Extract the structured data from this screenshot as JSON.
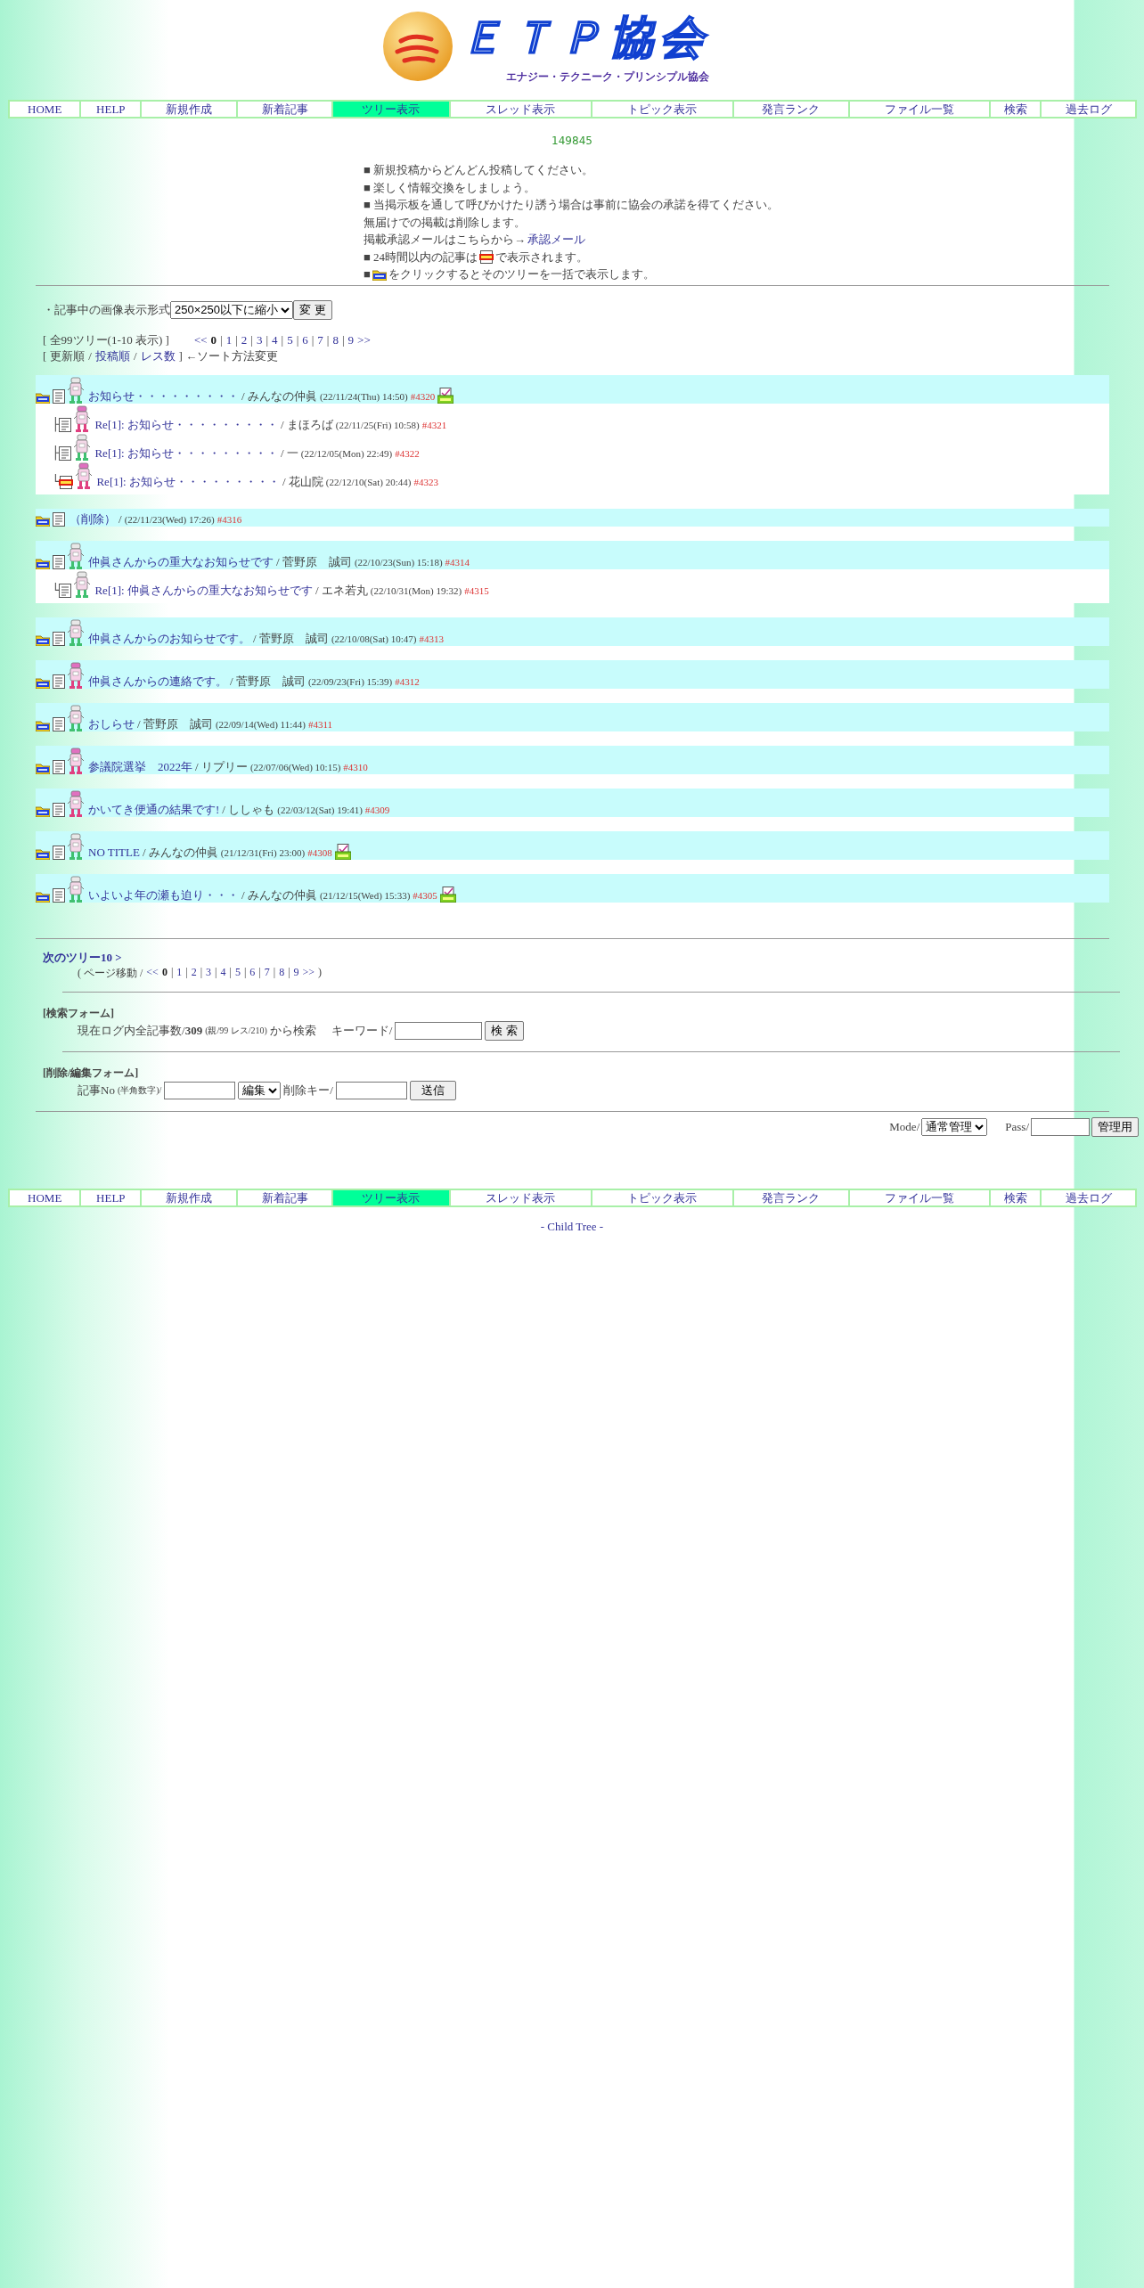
{
  "logo": {
    "title": "ＥＴＰ協会",
    "subtitle": "エナジー・テクニーク・プリンシプル協会"
  },
  "nav_top": [
    {
      "label": "HOME",
      "selected": false
    },
    {
      "label": "HELP",
      "selected": false
    },
    {
      "label": "新規作成",
      "selected": false
    },
    {
      "label": "新着記事",
      "selected": false
    },
    {
      "label": "ツリー表示",
      "selected": true
    },
    {
      "label": "スレッド表示",
      "selected": false
    },
    {
      "label": "トピック表示",
      "selected": false
    },
    {
      "label": "発言ランク",
      "selected": false
    },
    {
      "label": "ファイル一覧",
      "selected": false
    },
    {
      "label": "検索",
      "selected": false
    },
    {
      "label": "過去ログ",
      "selected": false
    }
  ],
  "counter": "149845",
  "notices": [
    {
      "kind": "text",
      "text": "■ 新規投稿からどんどん投稿してください。"
    },
    {
      "kind": "text",
      "text": "■ 楽しく情報交換をしましょう。"
    },
    {
      "kind": "text",
      "text": "■ 当掲示板を通して呼びかけたり誘う場合は事前に協会の承諾を得てください。"
    },
    {
      "kind": "text",
      "text": "無届けでの掲載は削除します。"
    },
    {
      "kind": "link",
      "text": "掲載承認メールはこちらから→",
      "link": "承認メール"
    },
    {
      "kind": "new_icon",
      "before": "■ 24時間以内の記事は",
      "after": "で表示されます。"
    },
    {
      "kind": "all_icon",
      "before": "■",
      "after": "をクリックするとそのツリーを一括で表示します。"
    }
  ],
  "image_format": {
    "label": "・記事中の画像表示形式",
    "value": "250×250以下に縮小",
    "button": "変 更"
  },
  "summary": "[ 全99ツリー(1-10 表示) ]",
  "pages": {
    "prev": "<<",
    "next": ">>",
    "separator": "|",
    "items": [
      {
        "label": "0",
        "selected": true
      },
      {
        "label": "1",
        "selected": false
      },
      {
        "label": "2",
        "selected": false
      },
      {
        "label": "3",
        "selected": false
      },
      {
        "label": "4",
        "selected": false
      },
      {
        "label": "5",
        "selected": false
      },
      {
        "label": "6",
        "selected": false
      },
      {
        "label": "7",
        "selected": false
      },
      {
        "label": "8",
        "selected": false
      },
      {
        "label": "9",
        "selected": false
      }
    ]
  },
  "sort": {
    "open": "[",
    "separator": "/",
    "close": "] ←ソート方法変更",
    "options": [
      {
        "label": "更新順",
        "selected": true
      },
      {
        "label": "投稿順",
        "selected": false
      },
      {
        "label": "レス数",
        "selected": false
      }
    ]
  },
  "threads": [
    {
      "post": {
        "title": "お知らせ・・・・・・・・・",
        "byline": "/ みんなの仲眞",
        "date": "(22/11/24(Thu) 14:50)",
        "number": "#4320",
        "kind": "green",
        "new": false,
        "image": true
      },
      "children": [
        {
          "branch": "├",
          "title": "Re[1]: お知らせ・・・・・・・・・",
          "byline": "/ まほろば",
          "date": "(22/11/25(Fri) 10:58)",
          "number": "#4321",
          "kind": "pink",
          "new": false
        },
        {
          "branch": "├",
          "title": "Re[1]: お知らせ・・・・・・・・・",
          "byline": "/ 一",
          "date": "(22/12/05(Mon) 22:49)",
          "number": "#4322",
          "kind": "green",
          "new": false
        },
        {
          "branch": "└",
          "title": "Re[1]: お知らせ・・・・・・・・・",
          "byline": "/ 花山院",
          "date": "(22/12/10(Sat) 20:44)",
          "number": "#4323",
          "kind": "pink",
          "new": true
        }
      ]
    },
    {
      "post": {
        "title": "（削除）",
        "byline": "/",
        "date": "(22/11/23(Wed) 17:26)",
        "number": "#4316",
        "kind": "deleted",
        "new": false
      }
    },
    {
      "post": {
        "title": "仲眞さんからの重大なお知らせです",
        "byline": "/ 菅野原　誠司",
        "date": "(22/10/23(Sun) 15:18)",
        "number": "#4314",
        "kind": "green",
        "new": false
      },
      "children": [
        {
          "branch": "└",
          "title": "Re[1]: 仲眞さんからの重大なお知らせです",
          "byline": "/ エネ若丸",
          "date": "(22/10/31(Mon) 19:32)",
          "number": "#4315",
          "kind": "green",
          "new": false
        }
      ]
    },
    {
      "post": {
        "title": "仲眞さんからのお知らせです。",
        "byline": "/ 菅野原　誠司",
        "date": "(22/10/08(Sat) 10:47)",
        "number": "#4313",
        "kind": "green",
        "new": false
      }
    },
    {
      "post": {
        "title": "仲眞さんからの連絡です。",
        "byline": "/ 菅野原　誠司",
        "date": "(22/09/23(Fri) 15:39)",
        "number": "#4312",
        "kind": "pink",
        "new": false
      }
    },
    {
      "post": {
        "title": "おしらせ",
        "byline": "/ 菅野原　誠司",
        "date": "(22/09/14(Wed) 11:44)",
        "number": "#4311",
        "kind": "green",
        "new": false
      }
    },
    {
      "post": {
        "title": "参議院選挙　2022年",
        "byline": "/ リプリー",
        "date": "(22/07/06(Wed) 10:15)",
        "number": "#4310",
        "kind": "pink",
        "new": false
      }
    },
    {
      "post": {
        "title": "かいてき便通の結果です!",
        "byline": "/ ししゃも",
        "date": "(22/03/12(Sat) 19:41)",
        "number": "#4309",
        "kind": "pink",
        "new": false
      }
    },
    {
      "post": {
        "title": "NO TITLE",
        "byline": "/ みんなの仲眞",
        "date": "(21/12/31(Fri) 23:00)",
        "number": "#4308",
        "kind": "green",
        "new": false,
        "image": true
      }
    },
    {
      "post": {
        "title": "いよいよ年の瀬も迫り・・・",
        "byline": "/ みんなの仲眞",
        "date": "(21/12/15(Wed) 15:33)",
        "number": "#4305",
        "kind": "green",
        "new": false,
        "image": true
      }
    }
  ],
  "next_tree": "次のツリー10 >",
  "page_move": {
    "open": "( ページ移動 /",
    "close": ")",
    "prev": "<<",
    "next": ">>",
    "separator": "|",
    "items": [
      {
        "label": "0",
        "selected": true
      },
      {
        "label": "1",
        "selected": false
      },
      {
        "label": "2",
        "selected": false
      },
      {
        "label": "3",
        "selected": false
      },
      {
        "label": "4",
        "selected": false
      },
      {
        "label": "5",
        "selected": false
      },
      {
        "label": "6",
        "selected": false
      },
      {
        "label": "7",
        "selected": false
      },
      {
        "label": "8",
        "selected": false
      },
      {
        "label": "9",
        "selected": false
      }
    ]
  },
  "search_form": {
    "heading": "[検索フォーム]",
    "count": "現在ログ内全記事数/**309**",
    "detail": "(親/99 レス/210)",
    "after": "から検索",
    "keyword_label": "キーワード/",
    "button": "検 索"
  },
  "edit_form": {
    "heading": "[削除/編集フォーム]",
    "no_label": "記事No",
    "no_hint": "(半角数字)/",
    "mode": "編集",
    "key_label": "削除キー/",
    "button": "送信"
  },
  "admin": {
    "mode_label": "Mode/",
    "mode": "通常管理",
    "pass_label": "Pass/",
    "button": "管理用"
  },
  "nav_bottom": [
    {
      "label": "HOME",
      "selected": false
    },
    {
      "label": "HELP",
      "selected": false
    },
    {
      "label": "新規作成",
      "selected": false
    },
    {
      "label": "新着記事",
      "selected": false
    },
    {
      "label": "ツリー表示",
      "selected": true
    },
    {
      "label": "スレッド表示",
      "selected": false
    },
    {
      "label": "トピック表示",
      "selected": false
    },
    {
      "label": "発言ランク",
      "selected": false
    },
    {
      "label": "ファイル一覧",
      "selected": false
    },
    {
      "label": "検索",
      "selected": false
    },
    {
      "label": "過去ログ",
      "selected": false
    }
  ],
  "footer": "- Child Tree -"
}
